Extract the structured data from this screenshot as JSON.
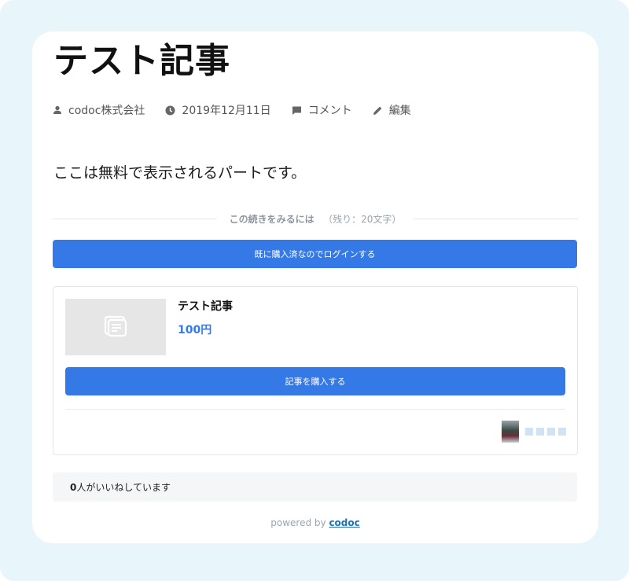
{
  "article": {
    "title": "テスト記事",
    "body": "ここは無料で表示されるパートです。"
  },
  "meta": {
    "author": "codoc株式会社",
    "date": "2019年12月11日",
    "comment": "コメント",
    "edit": "編集"
  },
  "paywall": {
    "continue_label": "この続きをみるには",
    "remaining": "（残り：20文字）",
    "login_button": "既に購入済なのでログインする"
  },
  "product": {
    "title": "テスト記事",
    "price": "100円",
    "buy_button": "記事を購入する"
  },
  "likes": {
    "count": "0",
    "suffix": "人がいいねしています"
  },
  "footer": {
    "powered_by": "powered by",
    "brand": "codoc"
  },
  "colors": {
    "accent": "#3479e6",
    "outer_background": "#e8f5fb"
  }
}
